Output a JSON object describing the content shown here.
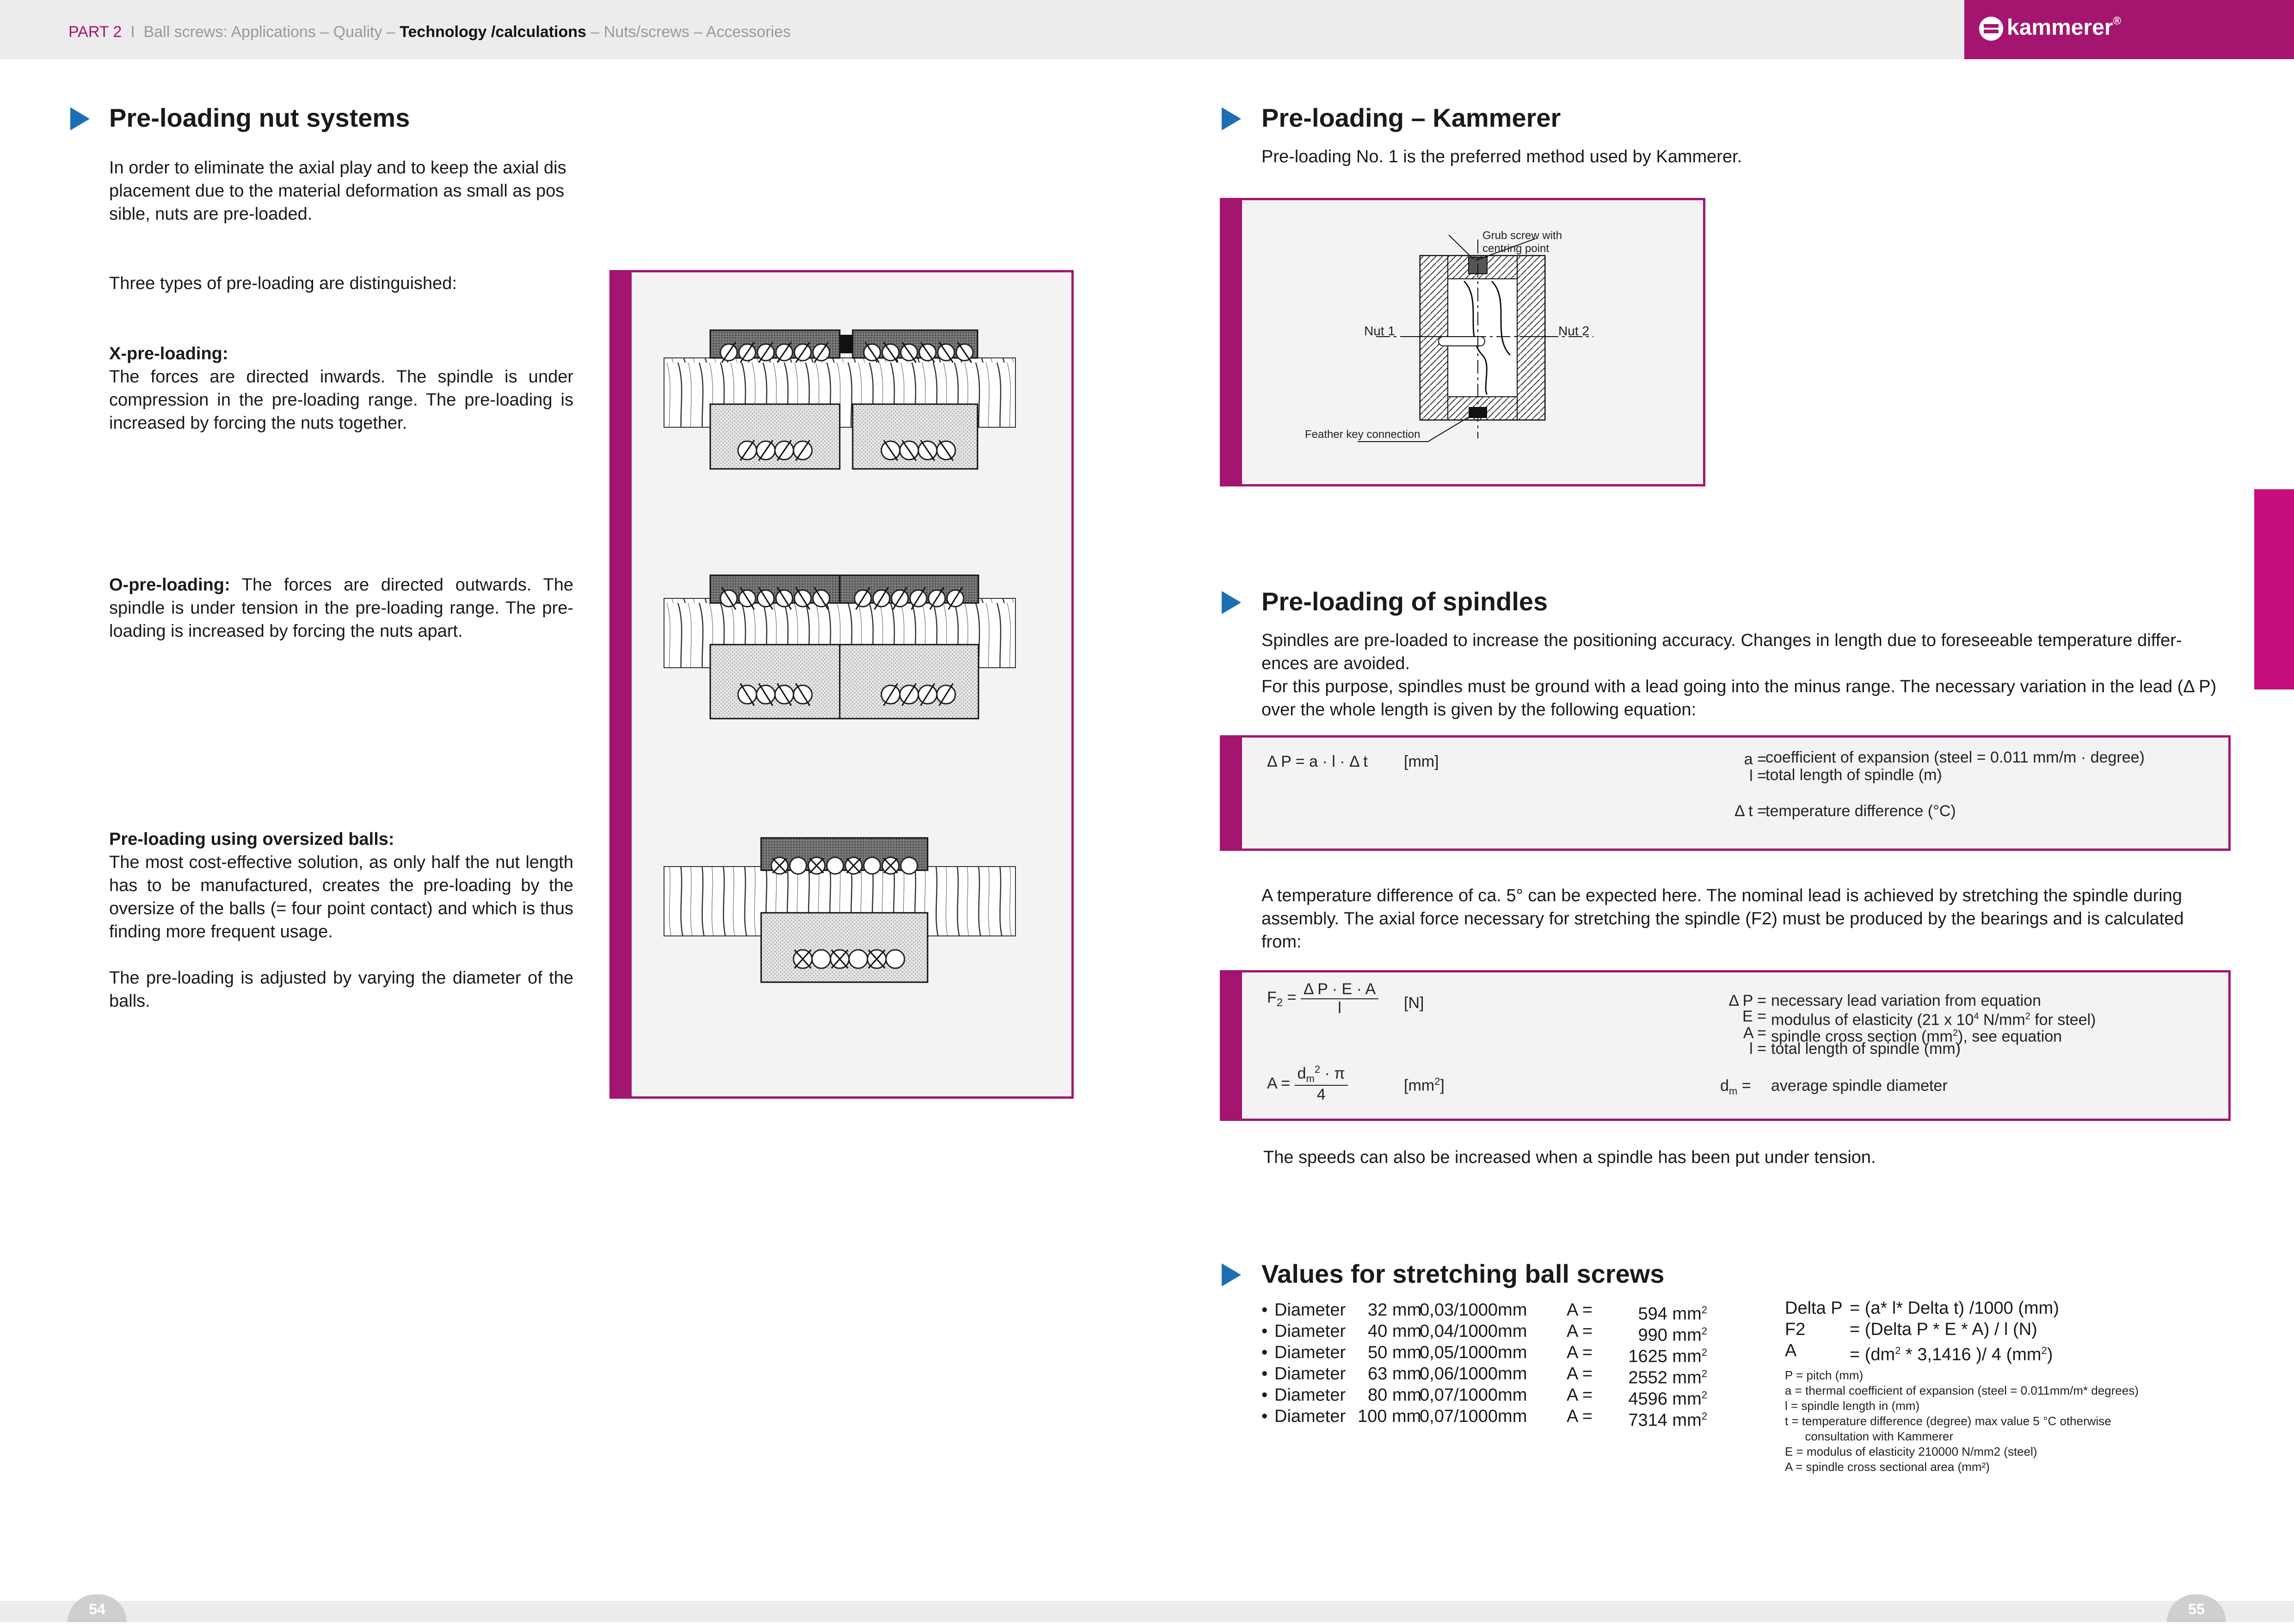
{
  "header": {
    "part": "PART 2",
    "sep": "I",
    "crumb_pre": "Ball screws: Applications – Quality –",
    "crumb_current": "Technology /calculations",
    "crumb_post": "– Nuts/screws – Accessories",
    "logo_text": "kammerer",
    "logo_mark": "®",
    "brand_color": "#a3156f"
  },
  "left": {
    "title": "Pre-loading nut systems",
    "intro": "In order to eliminate the axial play and to keep the axial dis placement due to the material deformation as small as pos sible, nuts are pre-loaded.",
    "types_intro": "Three types of pre-loading are distinguished:",
    "x_title": "X-pre-loading:",
    "x_text": "The forces are directed inwards. The spindle is under compression in the pre-loading range. The pre-loading is increased by forcing the nuts together.",
    "o_title": "O-pre-loading:",
    "o_text": "The forces are directed outwards. The spindle is under tension in the pre-loading range. The pre-loading is increased by forcing the nuts apart.",
    "b_title": "Pre-loading using oversized balls:",
    "b_text": "The most cost-effective solution, as only half the nut length has to be manufactured, creates the pre-loading by the oversize of the balls (= four point contact) and which is thus finding more frequent usage.",
    "b_text2": "The pre-loading is adjusted by varying the diameter of the balls."
  },
  "kammerer": {
    "title": "Pre-loading – Kammerer",
    "text": "Pre-loading No. 1 is the preferred method used by Kammerer.",
    "label_grub": "Grub screw with",
    "label_grub2": "centring point",
    "label_nut1": "Nut 1",
    "label_nut2": "Nut 2",
    "label_feather": "Feather key connection"
  },
  "spindles": {
    "title": "Pre-loading of spindles",
    "text1": "Spindles are pre-loaded to increase the positioning accuracy. Changes in length due to foreseeable temperature differ-ences are avoided.",
    "text2": "For this purpose, spindles must be ground with a lead going into the minus range. The necessary variation in the lead (Δ P) over the whole length is given by the following equation:",
    "eq1": {
      "formula": "Δ P = a · l · Δ t",
      "unit": "[mm]",
      "def_a_sym": "a =",
      "def_a": "coefficient of expansion (steel = 0.011 mm/m · degree)",
      "def_l_sym": "l =",
      "def_l": "total length of spindle (m)",
      "def_t_sym": "Δ t =",
      "def_t": "temperature difference (°C)"
    },
    "text3": "A temperature difference of ca. 5° can be expected here. The nominal lead is achieved by stretching the spindle during assembly. The axial force necessary for stretching the spindle (F2) must be produced by the bearings and is calculated from:",
    "eq2": {
      "lhs": "F",
      "lhs_sub": "2",
      "eq": "=",
      "num": "Δ P · E · A",
      "den": "l",
      "unit": "[N]",
      "def1_sym": "Δ P =",
      "def1": "necessary lead variation from equation",
      "def2_sym": "E =",
      "def2": "modulus of elasticity (21 x 10",
      "def2_sup": "4",
      "def2_tail": " N/mm",
      "def2_sup2": "2",
      "def2_end": " for steel)",
      "def3_sym": "A =",
      "def3": "spindle cross section (mm",
      "def3_sup": "2",
      "def3_end": "), see equation",
      "def4_sym": "l =",
      "def4": "total length of spindle (mm)",
      "a_lhs": "A =",
      "a_num": "d",
      "a_num_sub": "m",
      "a_num_sup": "2",
      "a_num_tail": " · π",
      "a_den": "4",
      "a_unit": "[mm",
      "a_unit_sup": "2",
      "a_unit_end": "]",
      "def5_sym": "d",
      "def5_sub": "m",
      "def5_eq": "=",
      "def5": "average spindle diameter"
    },
    "text4": "The speeds can also be increased when a spindle has been put under tension."
  },
  "values": {
    "title": "Values for stretching ball screws",
    "rows": [
      {
        "bullet": "•",
        "label": "Diameter",
        "d": "32 mm",
        "ratio": "0,03/1000mm",
        "a": "A =",
        "area": "594 mm",
        "sup": "2"
      },
      {
        "bullet": "•",
        "label": "Diameter",
        "d": "40 mm",
        "ratio": "0,04/1000mm",
        "a": "A =",
        "area": "990 mm",
        "sup": "2"
      },
      {
        "bullet": "•",
        "label": "Diameter",
        "d": "50 mm",
        "ratio": "0,05/1000mm",
        "a": "A =",
        "area": "1625 mm",
        "sup": "2"
      },
      {
        "bullet": "•",
        "label": "Diameter",
        "d": "63 mm",
        "ratio": "0,06/1000mm",
        "a": "A =",
        "area": "2552 mm",
        "sup": "2"
      },
      {
        "bullet": "•",
        "label": "Diameter",
        "d": "80 mm",
        "ratio": "0,07/1000mm",
        "a": "A =",
        "area": "4596 mm",
        "sup": "2"
      },
      {
        "bullet": "•",
        "label": "Diameter",
        "d": "100 mm",
        "ratio": "0,07/1000mm",
        "a": "A =",
        "area": "7314 mm",
        "sup": "2"
      }
    ],
    "f1_lhs": "Delta P",
    "f1_rhs": "= (a* l* Delta t) /1000 (mm)",
    "f2_lhs": "F2",
    "f2_rhs": "= (Delta P * E * A) / l   (N)",
    "f3_lhs": "A",
    "f3_rhs": "= (dm",
    "f3_sup": "2",
    "f3_tail": " * 3,1416 )/ 4    (mm",
    "f3_sup2": "2",
    "f3_end": ")",
    "legend": [
      "P = pitch (mm)",
      "a = thermal coefficient of expansion (steel = 0.011mm/m* degrees)",
      "l  = spindle length in (mm)",
      "t  = temperature difference (degree) max value 5 °C otherwise",
      "      consultation with Kammerer",
      "E = modulus of elasticity 210000 N/mm2 (steel)",
      "A = spindle cross sectional area (mm²)"
    ]
  },
  "footer": {
    "page_left": "54",
    "page_right": "55"
  }
}
